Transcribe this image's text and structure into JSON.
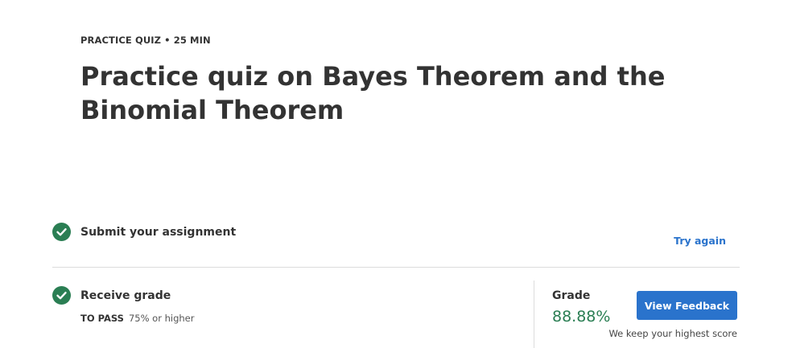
{
  "header": {
    "eyebrow": "PRACTICE QUIZ • 25 MIN",
    "title": "Practice quiz on Bayes Theorem and the Binomial Theorem"
  },
  "steps": [
    {
      "icon": "check-circle-icon",
      "title": "Submit your assignment",
      "action_label": "Try again"
    },
    {
      "icon": "check-circle-icon",
      "title": "Receive grade",
      "pass_label": "TO PASS",
      "pass_value": "75% or higher"
    }
  ],
  "grade": {
    "label": "Grade",
    "value": "88.88%",
    "button_label": "View Feedback",
    "note": "We keep your highest score"
  },
  "colors": {
    "accent": "#2a73cc",
    "success": "#2a7e53",
    "text": "#333333"
  }
}
